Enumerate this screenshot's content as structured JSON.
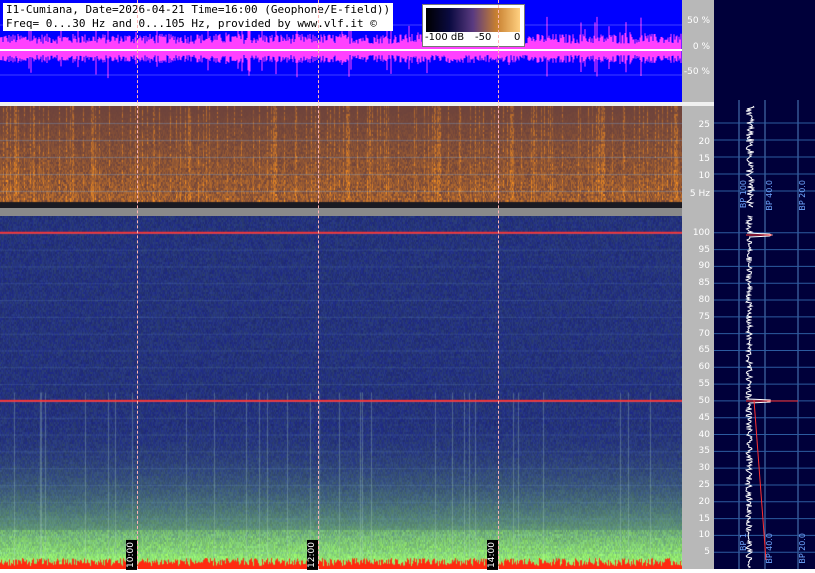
{
  "header": {
    "line1": "I1-Cumiana, Date=2026-04-21 Time=16:00 (Geophone/E-field))",
    "line2": "Freq= 0...30 Hz and 0...105 Hz, provided by www.vlf.it ©"
  },
  "colorbar": {
    "labels": [
      "-100 dB",
      "-50",
      "0"
    ]
  },
  "colors": {
    "waveform_bg": "#0000ff",
    "waveform_trace": "#ff40ff",
    "side_bg": "#00003a",
    "spec_high_bg": "#2a2e6e",
    "spec_low_bg": "#3a2a30",
    "marker_line": "#ff3030"
  },
  "chart_data": [
    {
      "type": "line",
      "panel": "waveform",
      "ylabel_ticks": [
        "50 %",
        "0 %",
        "-50 %"
      ],
      "y_values": [
        50,
        0,
        -50
      ]
    },
    {
      "type": "heatmap",
      "panel": "spectrogram 0-30 Hz",
      "ylim": [
        0,
        30
      ],
      "ticks": [
        "25",
        "20",
        "15",
        "10",
        "5 Hz"
      ],
      "tick_values": [
        25,
        20,
        15,
        10,
        5
      ]
    },
    {
      "type": "heatmap",
      "panel": "spectrogram 0-105 Hz",
      "ylim": [
        0,
        105
      ],
      "ticks": [
        "100",
        "95",
        "90",
        "85",
        "80",
        "75",
        "70",
        "65",
        "60",
        "55",
        "50",
        "45",
        "40",
        "35",
        "30",
        "25",
        "20",
        "15",
        "10",
        "5"
      ],
      "tick_values": [
        100,
        95,
        90,
        85,
        80,
        75,
        70,
        65,
        60,
        55,
        50,
        45,
        40,
        35,
        30,
        25,
        20,
        15,
        10,
        5
      ],
      "highlighted_lines_hz": [
        100,
        50
      ]
    },
    {
      "type": "line",
      "panel": "time markers",
      "x_labels": [
        "10:00",
        "12:00",
        "14:00"
      ]
    },
    {
      "type": "line",
      "panel": "side spectrum",
      "bp_labels_top": [
        "BP 100",
        "BP 40.0",
        "BP 20.0"
      ],
      "bp_labels_bottom": [
        "BP 1",
        "BP 40.0",
        "BP 20.0"
      ]
    }
  ]
}
